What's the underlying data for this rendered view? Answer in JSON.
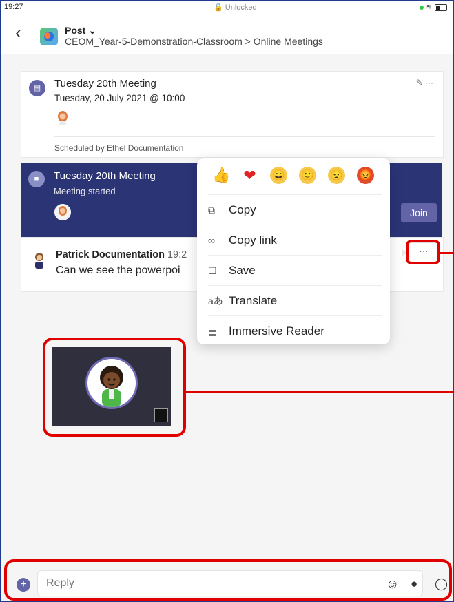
{
  "status_bar": {
    "time": "19:27",
    "lock_text": "Unlocked"
  },
  "header": {
    "title": "Post ⌄",
    "breadcrumb": "CEOM_Year-5-Demonstration-Classroom > Online Meetings"
  },
  "scheduled_card": {
    "title": "Tuesday 20th Meeting",
    "datetime": "Tuesday, 20 July 2021 @ 10:00",
    "scheduled_by": "Scheduled by Ethel Documentation",
    "actions": "✎ ···"
  },
  "meeting_card": {
    "title": "Tuesday 20th Meeting",
    "status": "Meeting started",
    "join_label": "Join"
  },
  "message": {
    "author": "Patrick Documentation",
    "time": "19:2",
    "text": "Can we see the powerpoi"
  },
  "more_button": "···",
  "context_menu": {
    "reactions": [
      "👍",
      "❤",
      "😄",
      "🙂",
      "😟",
      "😡"
    ],
    "items": [
      {
        "label": "Copy",
        "icon": "copy-icon",
        "glyph": "⧉"
      },
      {
        "label": "Copy link",
        "icon": "link-icon",
        "glyph": "∞"
      },
      {
        "label": "Save",
        "icon": "bookmark-icon",
        "glyph": "☐"
      },
      {
        "label": "Translate",
        "icon": "translate-icon",
        "glyph": "aあ"
      },
      {
        "label": "Immersive Reader",
        "icon": "immersive-reader-icon",
        "glyph": "▤"
      }
    ]
  },
  "reply": {
    "placeholder": "Reply"
  },
  "colors": {
    "accent": "#6264a7",
    "meeting_bg": "#2b3576",
    "highlight": "#e10000"
  }
}
